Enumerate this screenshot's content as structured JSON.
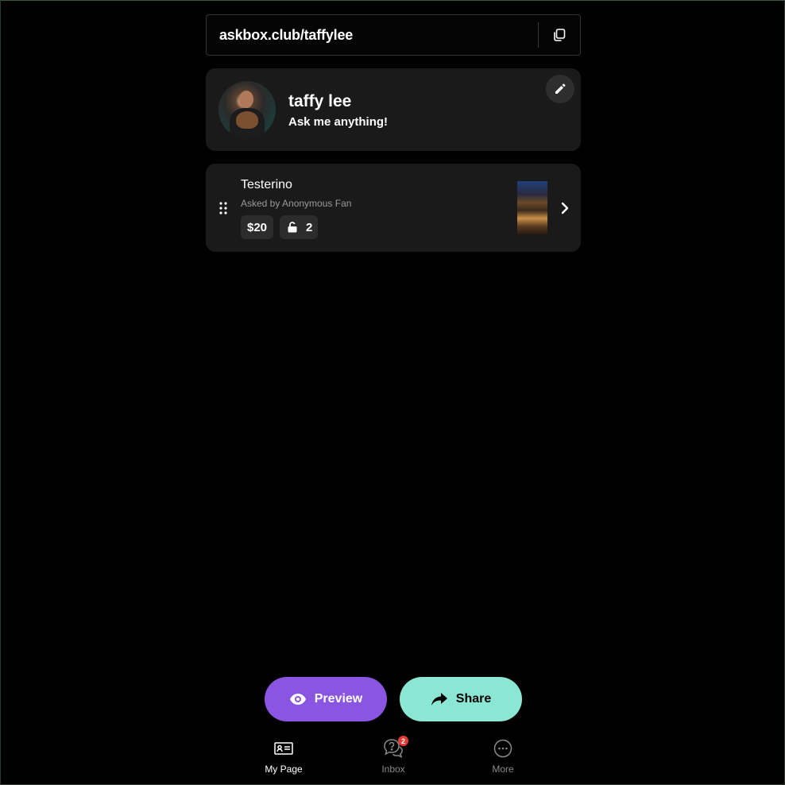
{
  "url_bar": {
    "url": "askbox.club/taffylee",
    "copy_icon": "copy-icon"
  },
  "profile": {
    "name": "taffy lee",
    "tagline": "Ask me anything!",
    "edit_icon": "pencil-icon"
  },
  "question": {
    "title": "Testerino",
    "asked_by": "Asked by Anonymous Fan",
    "price": "$20",
    "unlock_count": "2",
    "unlock_icon": "unlock-icon"
  },
  "actions": {
    "preview_label": "Preview",
    "share_label": "Share"
  },
  "nav": [
    {
      "label": "My Page",
      "icon": "profile-card-icon",
      "active": true
    },
    {
      "label": "Inbox",
      "icon": "question-bubble-icon",
      "badge": "2"
    },
    {
      "label": "More",
      "icon": "more-icon"
    }
  ],
  "colors": {
    "preview_accent": "#8a55e0",
    "share_accent": "#8ce6d4",
    "badge": "#e53935",
    "card_bg": "#1a1a1a"
  }
}
